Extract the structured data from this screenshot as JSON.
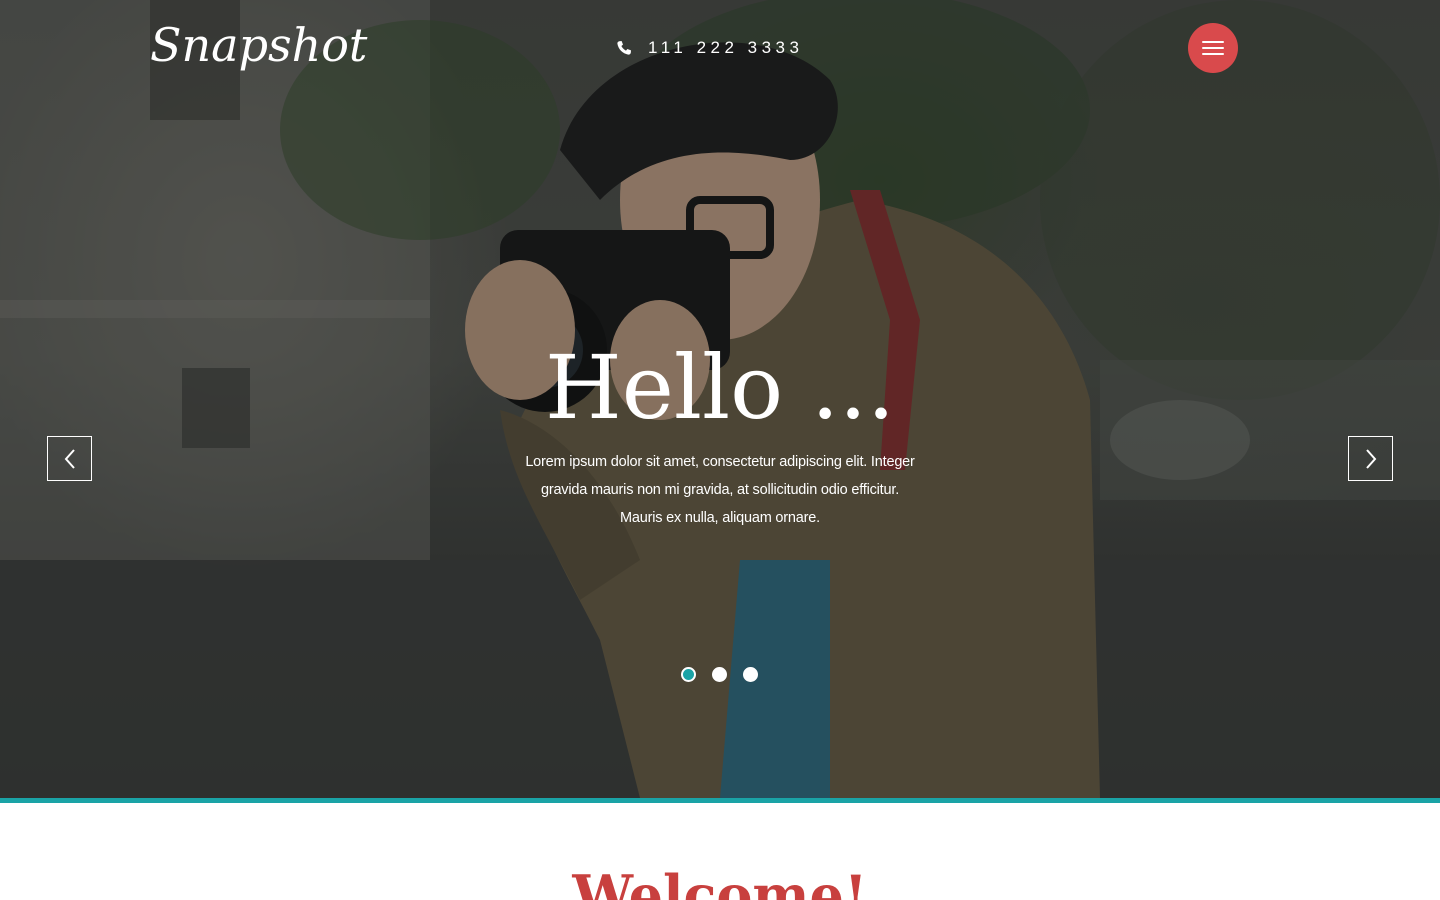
{
  "brand": {
    "logo_text": "Snapshot"
  },
  "header": {
    "phone_icon": "phone-icon",
    "phone_number": "111 222 3333",
    "menu_icon": "hamburger-icon",
    "menu_color": "#d94a4c"
  },
  "slider": {
    "title": "Hello ...",
    "text": "Lorem ipsum dolor sit amet, consectetur adipiscing elit. Integer gravida mauris non mi gravida, at sollicitudin odio efficitur. Mauris ex nulla, aliquam ornare.",
    "prev_icon": "chevron-left-icon",
    "next_icon": "chevron-right-icon",
    "slide_count": 3,
    "active_slide": 1
  },
  "accent_color": "#1aa3a6",
  "welcome": {
    "heading": "Welcome!"
  }
}
